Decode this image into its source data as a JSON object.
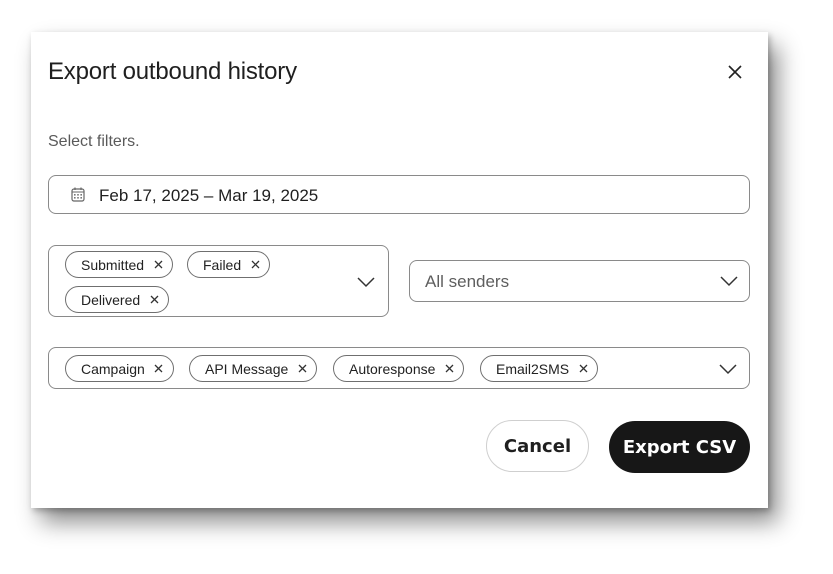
{
  "dialog": {
    "title": "Export outbound history",
    "subtitle": "Select filters."
  },
  "icons": {
    "close": "close-icon",
    "calendar": "calendar-icon",
    "chevron": "chevron-down-icon",
    "chip_remove": "x-icon"
  },
  "date_range": {
    "value": "Feb 17, 2025 – Mar 19, 2025"
  },
  "status_filter": {
    "chips": [
      "Submitted",
      "Failed",
      "Delivered"
    ]
  },
  "sender_filter": {
    "placeholder": "All senders"
  },
  "type_filter": {
    "chips": [
      "Campaign",
      "API Message",
      "Autoresponse",
      "Email2SMS"
    ]
  },
  "buttons": {
    "cancel": "Cancel",
    "export": "Export CSV"
  },
  "colors": {
    "primary_button": "#171717",
    "border": "#8a8a8a"
  }
}
